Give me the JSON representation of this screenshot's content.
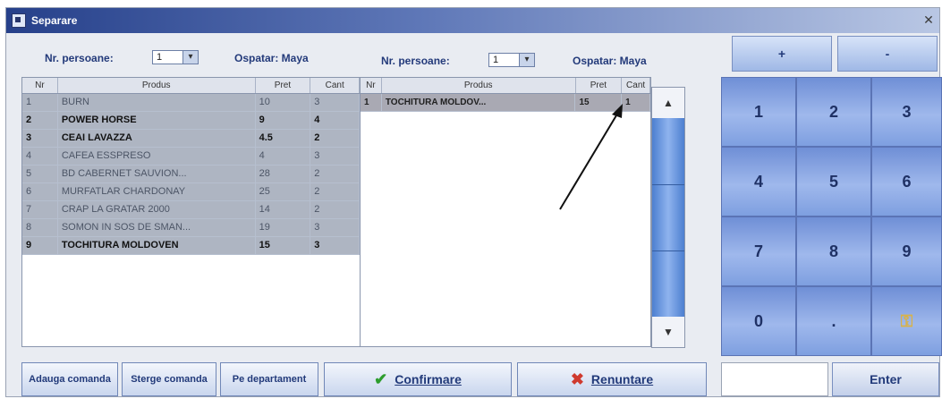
{
  "window": {
    "title": "Separare"
  },
  "left": {
    "persons_label": "Nr. persoane:",
    "persons_value": "1",
    "waiter": "Ospatar: Maya",
    "columns": [
      "Nr",
      "Produs",
      "Pret",
      "Cant"
    ],
    "rows": [
      {
        "nr": "1",
        "produs": "BURN",
        "pret": "10",
        "cant": "3"
      },
      {
        "nr": "2",
        "produs": "POWER HORSE",
        "pret": "9",
        "cant": "4"
      },
      {
        "nr": "3",
        "produs": "CEAI LAVAZZA",
        "pret": "4.5",
        "cant": "2"
      },
      {
        "nr": "4",
        "produs": "CAFEA ESSPRESO",
        "pret": "4",
        "cant": "3"
      },
      {
        "nr": "5",
        "produs": "BD CABERNET SAUVION...",
        "pret": "28",
        "cant": "2"
      },
      {
        "nr": "6",
        "produs": "MURFATLAR CHARDONAY",
        "pret": "25",
        "cant": "2"
      },
      {
        "nr": "7",
        "produs": "CRAP LA GRATAR 2000",
        "pret": "14",
        "cant": "2"
      },
      {
        "nr": "8",
        "produs": "SOMON IN SOS DE SMAN...",
        "pret": "19",
        "cant": "3"
      },
      {
        "nr": "9",
        "produs": "TOCHITURA MOLDOVEN",
        "pret": "15",
        "cant": "3"
      }
    ]
  },
  "right": {
    "persons_label": "Nr. persoane:",
    "persons_value": "1",
    "waiter": "Ospatar: Maya",
    "columns": [
      "Nr",
      "Produs",
      "Pret",
      "Cant"
    ],
    "rows": [
      {
        "nr": "1",
        "produs": "TOCHITURA MOLDOV...",
        "pret": "15",
        "cant": "1"
      }
    ]
  },
  "buttons": {
    "adauga": "Adauga comanda",
    "sterge": "Sterge comanda",
    "pe_departament": "Pe departament",
    "confirmare": "Confirmare",
    "renuntare": "Renuntare",
    "enter": "Enter",
    "plus": "+",
    "minus": "-"
  },
  "keypad": [
    "1",
    "2",
    "3",
    "4",
    "5",
    "6",
    "7",
    "8",
    "9",
    "0",
    "."
  ],
  "icons": {
    "check": "check-icon",
    "cancel": "x-icon",
    "backspace": "key-icon",
    "scroll_up": "triangle-up",
    "scroll_down": "triangle-down"
  },
  "colors": {
    "accent": "#223a7a",
    "keypad": "#8fa8e6",
    "scroll": "#6f9de4"
  }
}
